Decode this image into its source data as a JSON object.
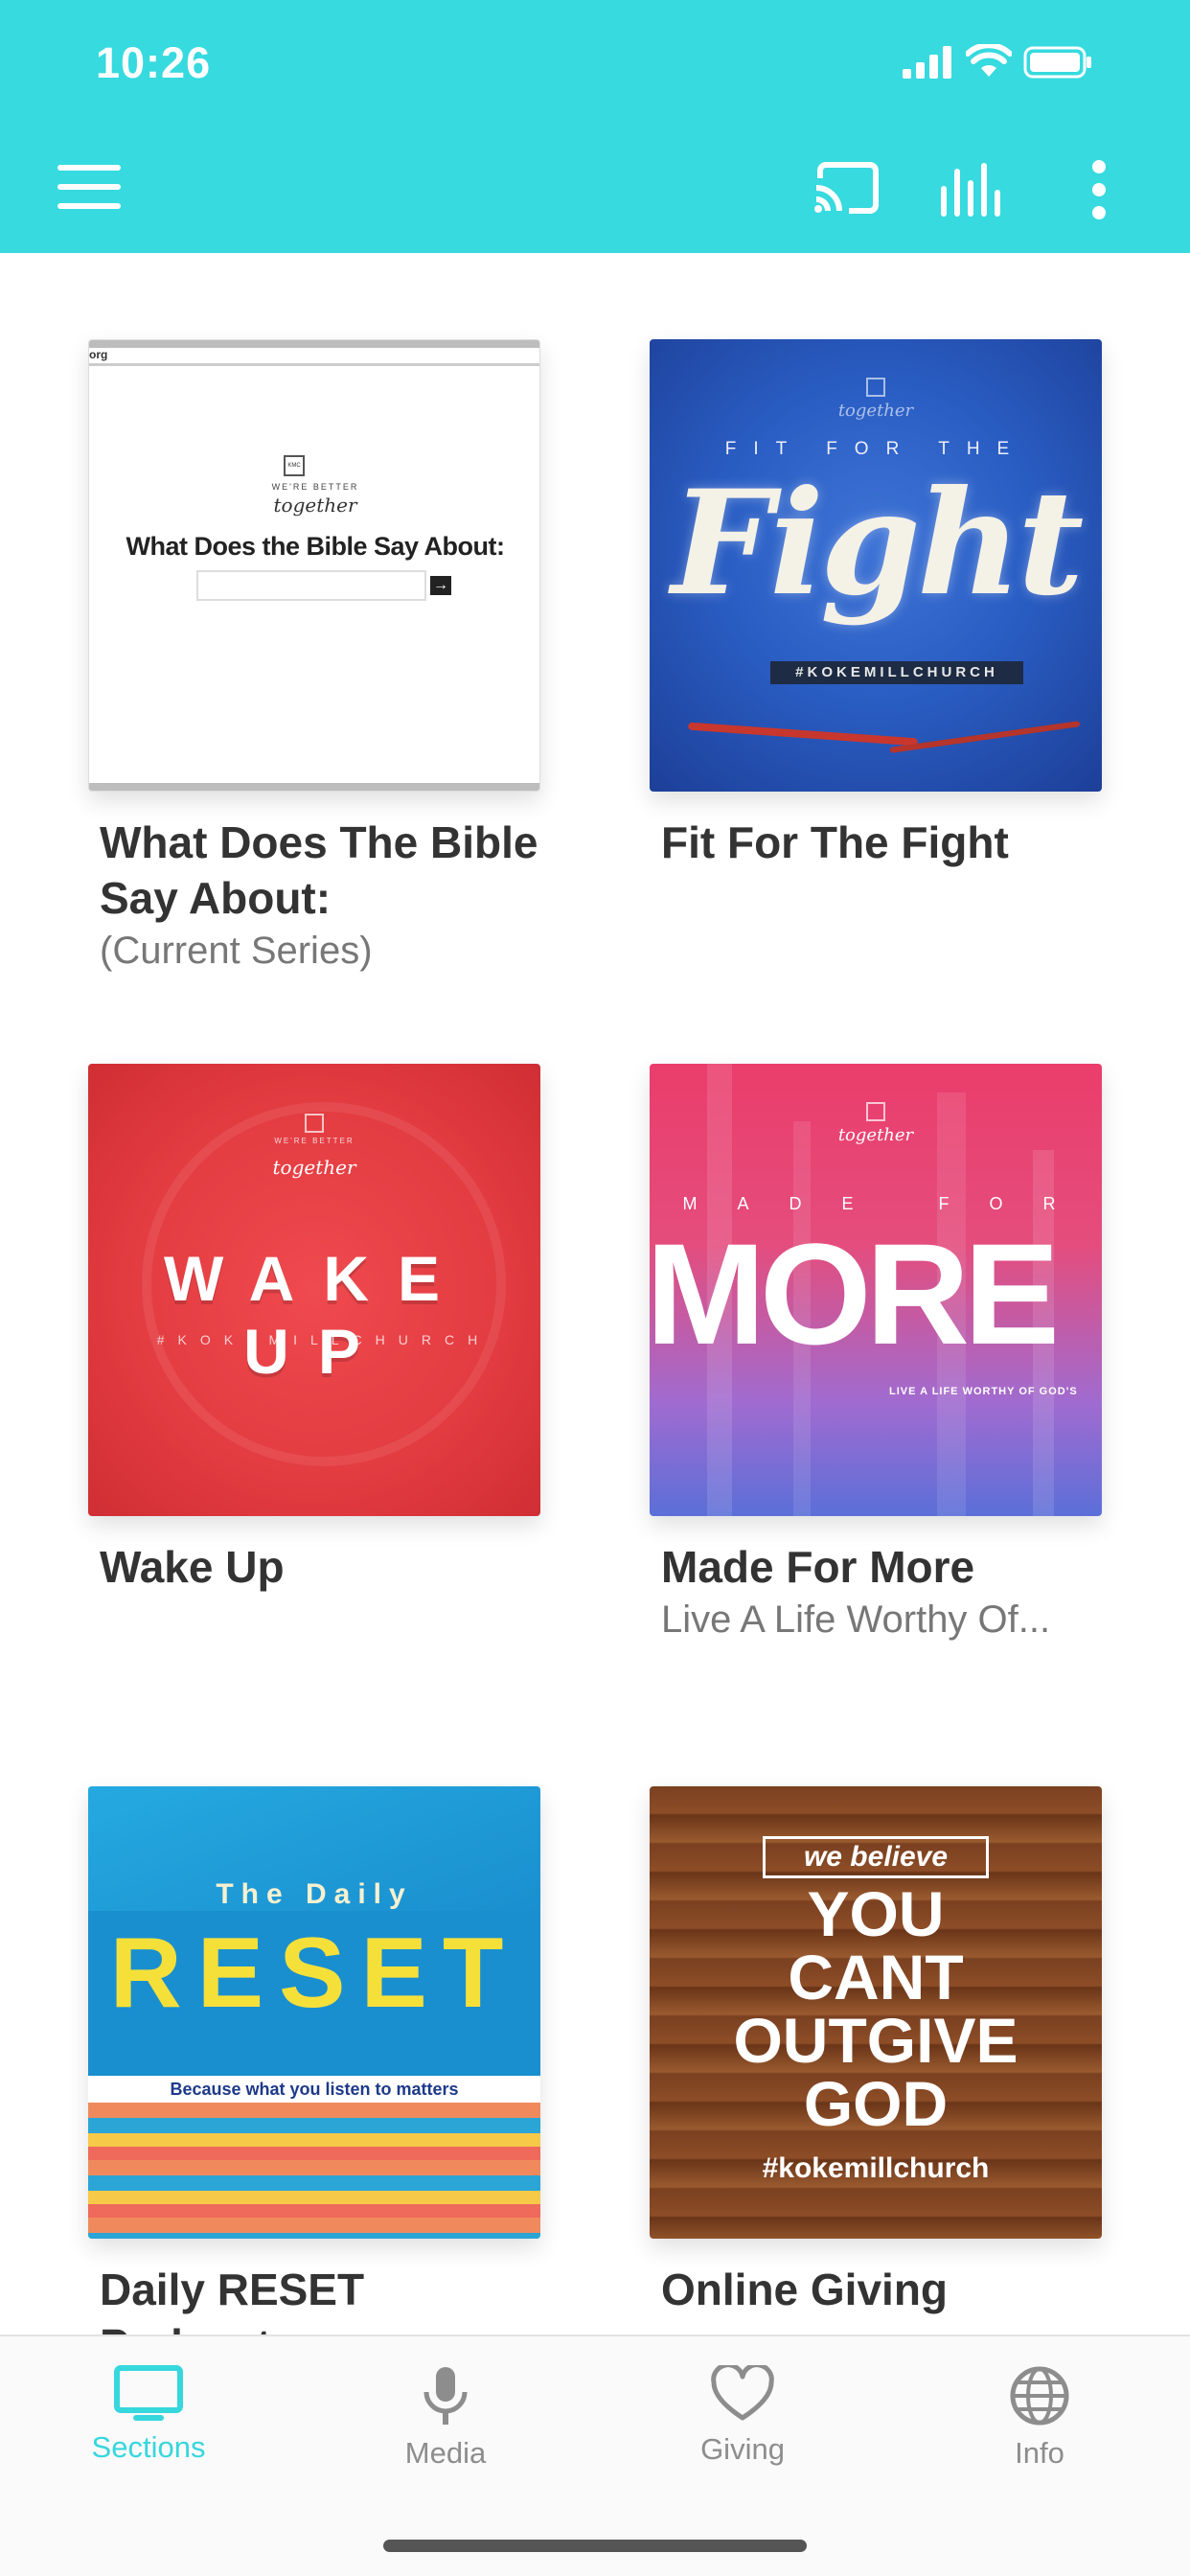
{
  "status_bar": {
    "time": "10:26"
  },
  "header": {
    "menu_icon": "hamburger-menu-icon",
    "cast_icon": "cast-icon",
    "audio_icon": "audio-equalizer-icon",
    "more_icon": "more-vertical-icon",
    "background_color": "#36dadf"
  },
  "cards": [
    {
      "title": "What Does The Bible Say About:",
      "subtitle": "(Current Series)",
      "art": {
        "kicker_top": "WE'RE BETTER",
        "script": "together",
        "headline": "What Does the Bible Say About:",
        "url_fragment": "org"
      }
    },
    {
      "title": "Fit For The Fight",
      "subtitle": "",
      "art": {
        "kicker": "FIT FOR THE",
        "headline": "Fight",
        "tag": "#KOKEMILLCHURCH",
        "script": "together"
      }
    },
    {
      "title": "Wake Up",
      "subtitle": "",
      "art": {
        "headline": "WAKE UP",
        "tag": "#KOKEMILLCHURCH",
        "script": "together",
        "kicker_top": "WE'RE BETTER"
      }
    },
    {
      "title": "Made For More",
      "subtitle": "Live A Life Worthy Of...",
      "art": {
        "kicker": "MADE FOR",
        "headline": "MORE",
        "tag": "LIVE A LIFE WORTHY OF GOD'S",
        "script": "together",
        "kicker_top": "WE'RE BETTER"
      }
    },
    {
      "title": "Daily RESET Podcast",
      "subtitle": "",
      "art": {
        "kicker": "The Daily",
        "headline": "RESET",
        "tagline": "Because what you listen to matters"
      }
    },
    {
      "title": "Online Giving",
      "subtitle": "",
      "art": {
        "badge": "we believe",
        "line1": "YOU",
        "line2": "CANT",
        "line3": "OUTGIVE",
        "line4": "GOD",
        "tag": "#kokemillchurch"
      }
    }
  ],
  "bottom_nav": {
    "items": [
      {
        "label": "Sections",
        "icon": "monitor-icon",
        "active": true
      },
      {
        "label": "Media",
        "icon": "microphone-icon",
        "active": false
      },
      {
        "label": "Giving",
        "icon": "heart-icon",
        "active": false
      },
      {
        "label": "Info",
        "icon": "globe-icon",
        "active": false
      }
    ],
    "active_color": "#36d7dd",
    "inactive_color": "#8d8d8d"
  }
}
